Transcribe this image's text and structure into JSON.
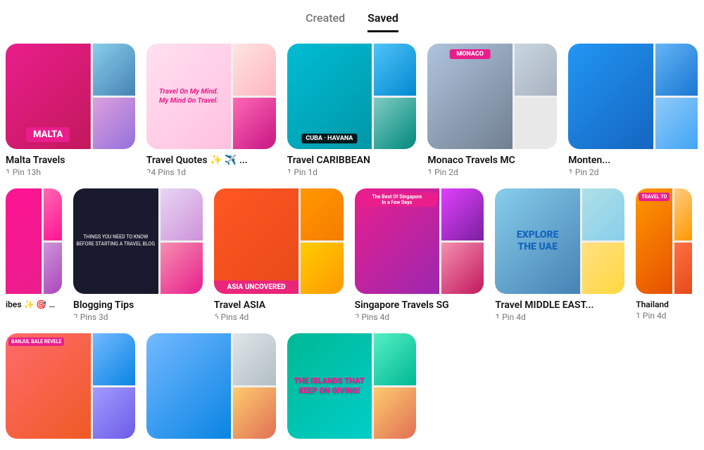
{
  "tabs": [
    {
      "id": "created",
      "label": "Created",
      "active": false
    },
    {
      "id": "saved",
      "label": "Saved",
      "active": true
    }
  ],
  "rows": [
    {
      "boards": [
        {
          "id": "malta",
          "title": "Malta Travels",
          "pins": "1 Pin",
          "time": "13h",
          "style": "malta",
          "partial": false
        },
        {
          "id": "quotes",
          "title": "Travel Quotes ✨ ✈️ ...",
          "pins": "24 Pins",
          "time": "1d",
          "style": "quotes",
          "partial": false
        },
        {
          "id": "caribbean",
          "title": "Travel CARIBBEAN",
          "pins": "1 Pin",
          "time": "1d",
          "style": "caribbean",
          "partial": false
        },
        {
          "id": "monaco",
          "title": "Monaco Travels MC",
          "pins": "1 Pin",
          "time": "2d",
          "style": "monaco",
          "partial": false
        },
        {
          "id": "monten",
          "title": "Monten...",
          "pins": "1 Pin",
          "time": "2d",
          "style": "monten",
          "partial": "right"
        }
      ]
    },
    {
      "boards": [
        {
          "id": "vibes",
          "title": "ibes ✨ 🎯 💙 ...",
          "pins": "",
          "time": "",
          "style": "vibes",
          "partial": "left"
        },
        {
          "id": "blogging",
          "title": "Blogging Tips",
          "pins": "2 Pins",
          "time": "3d",
          "style": "blog",
          "partial": false
        },
        {
          "id": "asia",
          "title": "Travel ASIA",
          "pins": "6 Pins",
          "time": "4d",
          "style": "asia",
          "partial": false
        },
        {
          "id": "singapore",
          "title": "Singapore Travels SG",
          "pins": "2 Pins",
          "time": "4d",
          "style": "singapore",
          "partial": false
        },
        {
          "id": "uae",
          "title": "Travel MIDDLE EAST...",
          "pins": "1 Pin",
          "time": "4d",
          "style": "uae",
          "partial": false
        },
        {
          "id": "thailand",
          "title": "Thailand",
          "pins": "1 Pin",
          "time": "4d",
          "style": "thailand",
          "partial": "right"
        }
      ]
    },
    {
      "boards": [
        {
          "id": "bali",
          "title": "",
          "pins": "",
          "time": "",
          "style": "bali",
          "partial": false
        },
        {
          "id": "windmill",
          "title": "",
          "pins": "",
          "time": "",
          "style": "windmill",
          "partial": false
        },
        {
          "id": "islands",
          "title": "The Islands That Keep On Giving!",
          "pins": "",
          "time": "",
          "style": "islands",
          "partial": false
        }
      ]
    }
  ],
  "colors": {
    "active_tab_border": "#111111",
    "inactive_tab": "#767676"
  }
}
